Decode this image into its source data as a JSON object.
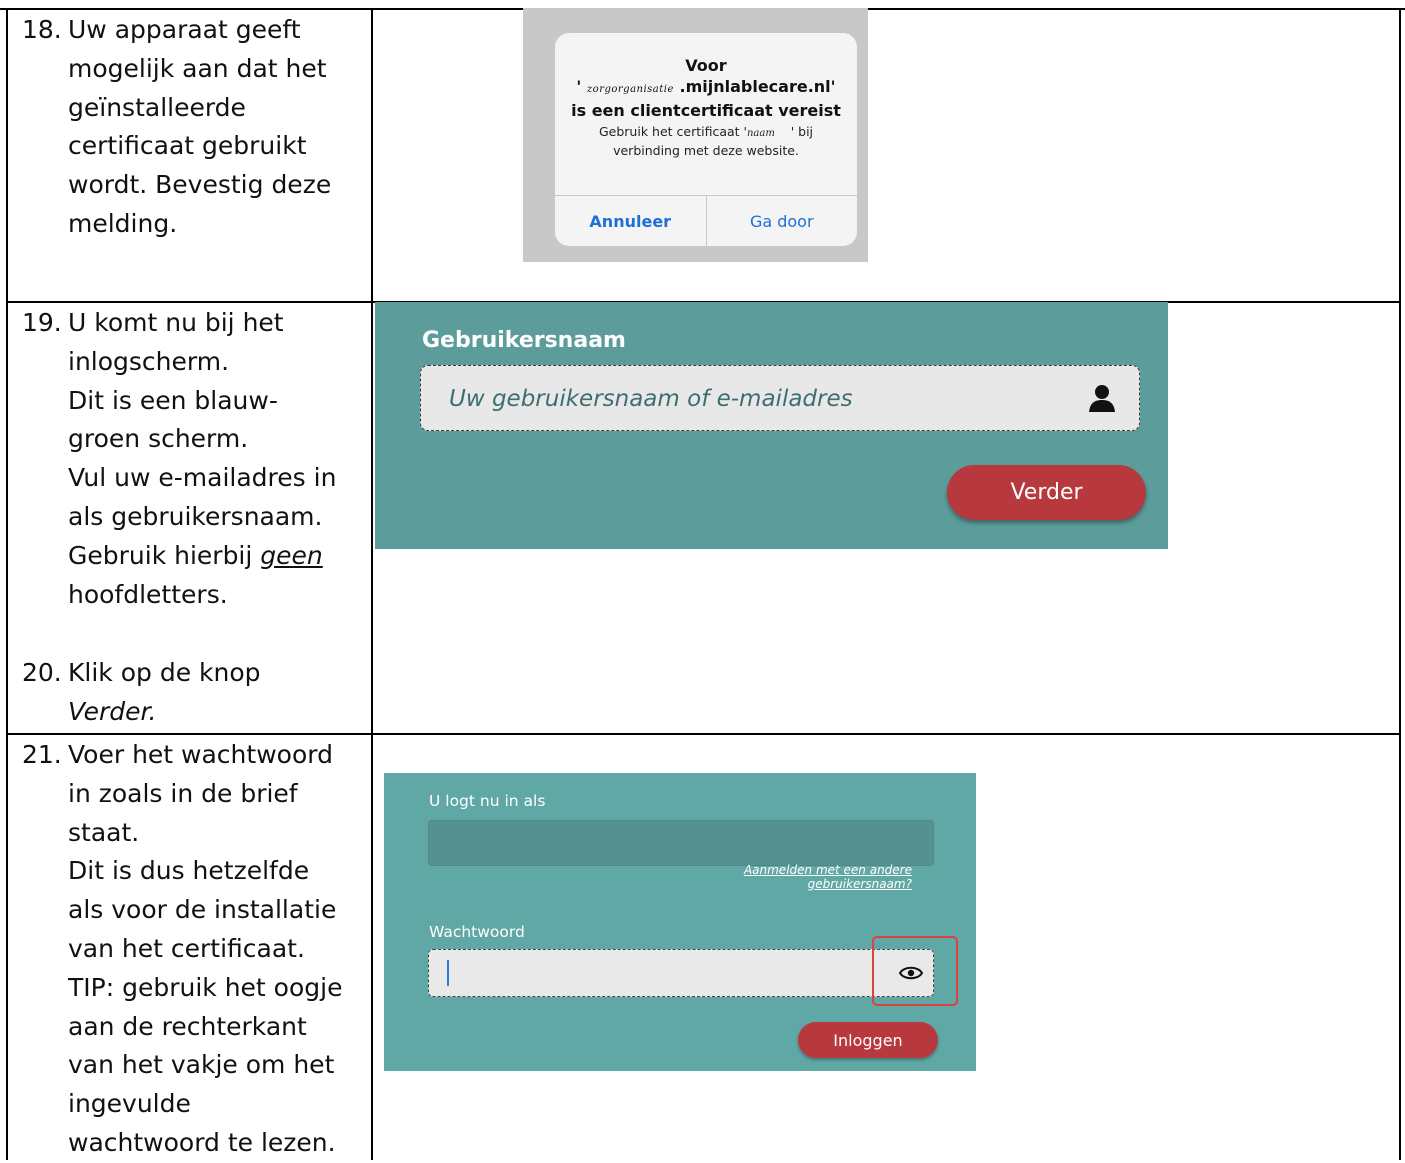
{
  "rows": [
    {
      "step": "18.",
      "lines": [
        "Uw apparaat geeft",
        "mogelijk aan dat het",
        "geïnstalleerde",
        "certificaat gebruikt",
        "wordt. Bevestig deze",
        "melding."
      ]
    },
    {
      "step": "19.",
      "lines": [
        "U komt nu bij het",
        "inlogscherm.",
        "Dit is een blauw-",
        "groen scherm.",
        "Vul uw e-mailadres in",
        "als gebruikersnaam."
      ],
      "line7_prefix": "Gebruik hierbij ",
      "line7_emph": "geen",
      "line8": "hoofdletters."
    },
    {
      "step": "20.",
      "line1": "Klik op de knop",
      "line2": "Verder."
    },
    {
      "step": "21.",
      "lines": [
        "Voer het wachtwoord",
        "in zoals in de brief",
        "staat.",
        "Dit is dus hetzelfde",
        "als voor de installatie",
        "van het certificaat.",
        "TIP: gebruik het oogje",
        "aan de rechterkant",
        "van het vakje om het",
        "ingevulde",
        "wachtwoord te lezen."
      ]
    }
  ],
  "alert": {
    "title": "Voor",
    "host_handwritten": "zorgorganisatie",
    "host_suffix": ".mijnlablecare.nl'",
    "host_prefix": "'",
    "subtitle": "is een clientcertificaat vereist",
    "msg_prefix": "Gebruik het certificaat '",
    "msg_handwritten": "naam",
    "msg_suffix": "' bij",
    "msg_line2": "verbinding met deze website.",
    "cancel_label": "Annuleer",
    "continue_label": "Ga door"
  },
  "username_screen": {
    "label": "Gebruikersnaam",
    "placeholder": "Uw gebruikersnaam of e-mailadres",
    "button": "Verder",
    "icon": "user-icon",
    "background": "#5c9d9b",
    "button_color": "#b7393e"
  },
  "password_screen": {
    "logged_in_label": "U logt nu in als",
    "other_user_link": "Aanmelden met een andere gebruikersnaam?",
    "password_label": "Wachtwoord",
    "button": "Inloggen",
    "icon": "eye-icon",
    "highlight_color": "#d9423f"
  }
}
